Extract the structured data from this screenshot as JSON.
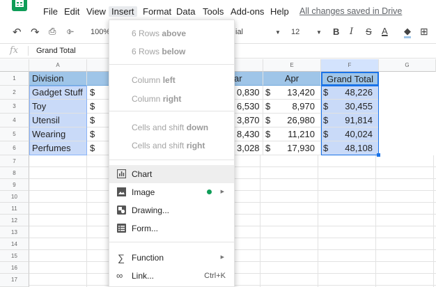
{
  "menubar": {
    "items": [
      "File",
      "Edit",
      "View",
      "Insert",
      "Format",
      "Data",
      "Tools",
      "Add-ons",
      "Help"
    ],
    "saved_status": "All changes saved in Drive"
  },
  "toolbar": {
    "zoom": "100%",
    "font": "ial",
    "font_size": "12",
    "bold": "B",
    "italic": "I",
    "strike": "S",
    "text_color": "A"
  },
  "formula_bar": {
    "fx": "fx",
    "value": "Grand Total"
  },
  "columns": [
    "A",
    "",
    "",
    "",
    "E",
    "F",
    "G"
  ],
  "rows": [
    "1",
    "2",
    "3",
    "4",
    "5",
    "6",
    "7",
    "8",
    "9",
    "10",
    "11",
    "12",
    "13",
    "14",
    "15",
    "16",
    "17"
  ],
  "table": {
    "headers": {
      "a": "Division",
      "d": "ar",
      "e": "Apr",
      "f": "Grand Total"
    },
    "currency": "$",
    "data": [
      {
        "division": "Gadget Stuff",
        "d": "0,830",
        "e": "13,420",
        "f": "48,226"
      },
      {
        "division": "Toy",
        "d": "6,530",
        "e": "8,970",
        "f": "30,455"
      },
      {
        "division": "Utensil",
        "d": "3,870",
        "e": "26,980",
        "f": "91,814"
      },
      {
        "division": "Wearing",
        "d": "8,430",
        "e": "11,210",
        "f": "40,024"
      },
      {
        "division": "Perfumes",
        "d": "3,028",
        "e": "17,930",
        "f": "48,108"
      }
    ]
  },
  "insert_menu": {
    "rows_above_pre": "6 Rows ",
    "rows_above_b": "above",
    "rows_below_pre": "6 Rows ",
    "rows_below_b": "below",
    "col_left_pre": "Column ",
    "col_left_b": "left",
    "col_right_pre": "Column ",
    "col_right_b": "right",
    "shift_down_pre": "Cells and shift ",
    "shift_down_b": "down",
    "shift_right_pre": "Cells and shift ",
    "shift_right_b": "right",
    "chart": "Chart",
    "image": "Image",
    "drawing": "Drawing...",
    "form": "Form...",
    "function": "Function",
    "link": "Link...",
    "link_shortcut": "Ctrl+K"
  },
  "colors": {
    "header_fill": "#9fc5e8",
    "selection": "#c9daf8",
    "accent": "#1a73e8",
    "sheets_green": "#0f9d58"
  }
}
